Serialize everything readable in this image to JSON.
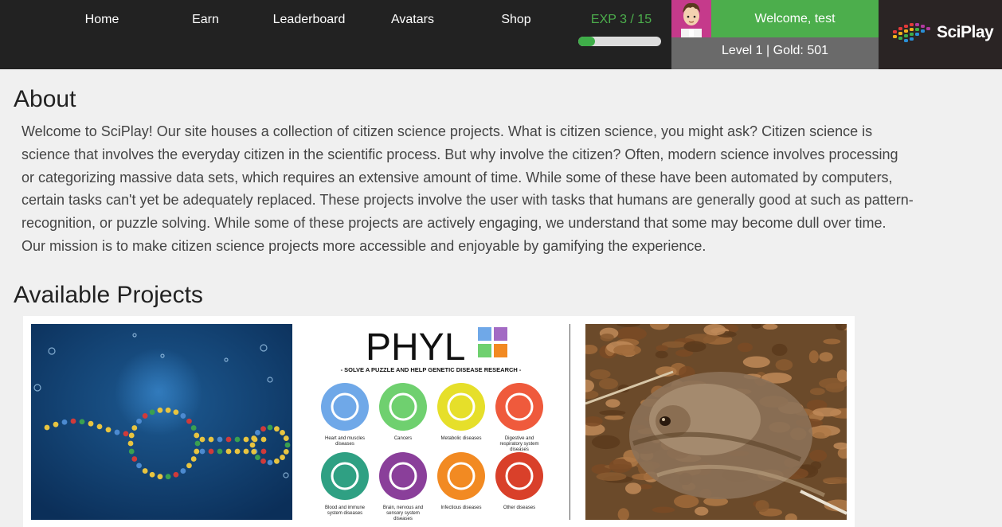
{
  "nav": {
    "items": [
      {
        "label": "Home"
      },
      {
        "label": "Earn"
      },
      {
        "label": "Leaderboard"
      },
      {
        "label": "Avatars"
      },
      {
        "label": "Shop"
      }
    ]
  },
  "user": {
    "exp_label": "EXP 3 / 15",
    "exp_fraction": 0.2,
    "welcome": "Welcome, test",
    "stats": "Level 1 | Gold: 501"
  },
  "brand": {
    "logo_text": "SciPlay"
  },
  "about": {
    "heading": "About",
    "body": "Welcome to SciPlay! Our site houses a collection of citizen science projects. What is citizen science, you might ask? Citizen science is science that involves the everyday citizen in the scientific process. But why involve the citizen? Often, modern science involves processing or categorizing massive data sets, which requires an extensive amount of time. While some of these have been automated by computers, certain tasks can't yet be adequately replaced. These projects involve the user with tasks that humans are generally good at such as pattern-recognition, or puzzle solving. While some of these projects are actively engaging, we understand that some may become dull over time. Our mission is to make citizen science projects more accessible and enjoyable by gamifying the experience."
  },
  "projects": {
    "heading": "Available Projects",
    "phylo": {
      "title": "PHYL",
      "subtitle": "- SOLVE A PUZZLE AND HELP GENETIC DISEASE RESEARCH -",
      "categories": [
        {
          "label1": "Heart and muscles",
          "label2": "diseases",
          "label3": "",
          "color": "#6fa8e8"
        },
        {
          "label1": "Cancers",
          "label2": "",
          "label3": "",
          "color": "#6fd06f"
        },
        {
          "label1": "Metabolic diseases",
          "label2": "",
          "label3": "",
          "color": "#e6df2a"
        },
        {
          "label1": "Digestive and",
          "label2": "respiratory system",
          "label3": "diseases",
          "color": "#ef5a3c"
        },
        {
          "label1": "Blood and immune",
          "label2": "system diseases",
          "label3": "",
          "color": "#2fa083"
        },
        {
          "label1": "Brain, nervous and",
          "label2": "sensory system",
          "label3": "diseases",
          "color": "#8a3f9a"
        },
        {
          "label1": "Infectious diseases",
          "label2": "",
          "label3": "",
          "color": "#f28a22"
        },
        {
          "label1": "Other diseases",
          "label2": "",
          "label3": "",
          "color": "#d9402a"
        }
      ]
    }
  },
  "colors": {
    "navbar": "#222222",
    "accent": "#4cae4c",
    "stats_bg": "#6a6a6a"
  }
}
